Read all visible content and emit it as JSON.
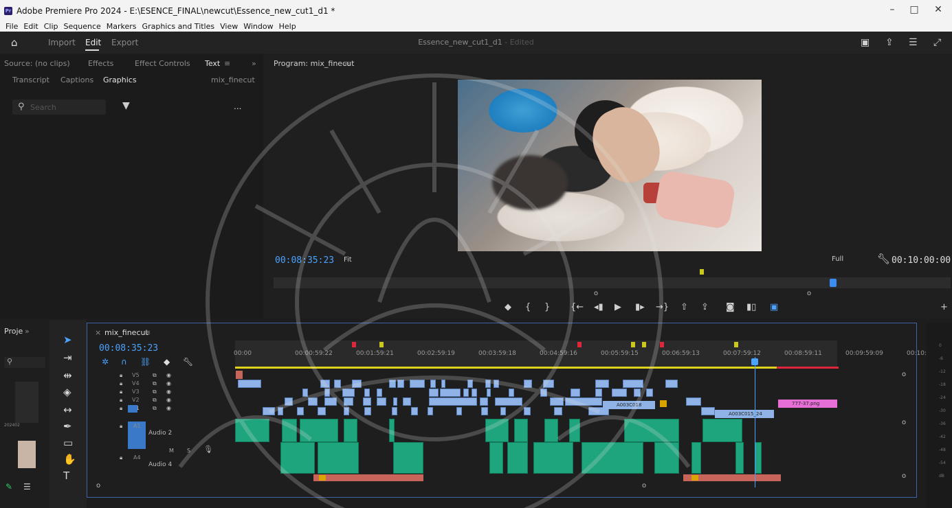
{
  "window": {
    "title": "Adobe Premiere Pro 2024 - E:\\ESENCE_FINAL\\newcut\\Essence_new_cut1_d1 *",
    "controls": [
      "–",
      "□",
      "✕"
    ]
  },
  "menu": [
    "File",
    "Edit",
    "Clip",
    "Sequence",
    "Markers",
    "Graphics and Titles",
    "View",
    "Window",
    "Help"
  ],
  "workspace": {
    "tabs": [
      "Import",
      "Edit",
      "Export"
    ],
    "active": "Edit",
    "document": "Essence_new_cut1_d1",
    "document_status": "- Edited"
  },
  "left_panel": {
    "tabs_row1": [
      "Source: (no clips)",
      "Effects",
      "Effect Controls",
      "Text"
    ],
    "tabs_row2": [
      "Transcript",
      "Captions",
      "Graphics"
    ],
    "active_tab": "Graphics",
    "sequence": "mix_finecut",
    "search_placeholder": "Search",
    "more": "..."
  },
  "program": {
    "tab_label": "Program: mix_finecut",
    "timecode": "00:08:35:23",
    "zoom": "Fit",
    "quality": "Full",
    "duration": "00:10:00:00",
    "playhead_fraction": 0.82
  },
  "timeline": {
    "sequence_tab": "mix_finecut",
    "timecode": "00:08:35:23",
    "ruler_labels": [
      "00:00",
      "00:00:59:22",
      "00:01:59:21",
      "00:02:59:19",
      "00:03:59:18",
      "00:04:59:16",
      "00:05:59:15",
      "00:06:59:13",
      "00:07:59:12",
      "00:08:59:11",
      "00:09:59:09",
      "00:10:"
    ],
    "video_tracks": [
      "V5",
      "V4",
      "V3",
      "V2",
      "V1"
    ],
    "audio_tracks": [
      "A1",
      "A4"
    ],
    "audio_names": [
      "Audio 2",
      "Audio 4"
    ],
    "clip_labels": [
      "A003C018",
      "A003C015_24",
      "777-37.png"
    ],
    "track_buttons": [
      "M",
      "S"
    ]
  },
  "project_panel": {
    "title": "Proje",
    "item": "202402"
  },
  "meter_labels": [
    "0",
    "-6",
    "-12",
    "-18",
    "-24",
    "-30",
    "-36",
    "-42",
    "-48",
    "-54",
    "dB"
  ],
  "colors": {
    "accent": "#4aa3ff",
    "video_clip": "#8fb3e6",
    "audio_clip": "#1fa57d",
    "marker_red": "#e0263a",
    "marker_yellow": "#c8c81e",
    "work_area": "#e0d21a"
  }
}
